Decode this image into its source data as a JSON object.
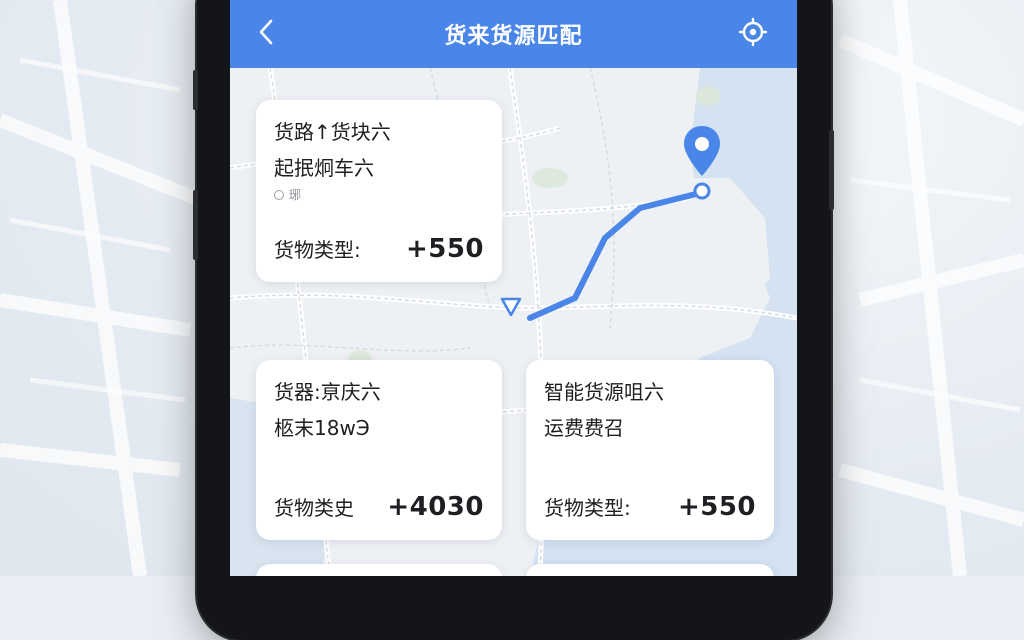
{
  "app": {
    "title": "货来货源匹配"
  },
  "icons": {
    "back": "chevron-left-icon",
    "locate": "location-target-icon",
    "destination": "map-pin-icon",
    "origin": "navigation-arrow-icon"
  },
  "colors": {
    "header": "#4a86e8",
    "route": "#4a86e8",
    "card_bg": "#ffffff"
  },
  "cards": [
    {
      "line1": "货路↑货块六",
      "line2": "起抿炯车六",
      "line3": "琊",
      "type_label": "货物类型:",
      "price": "+550"
    },
    {
      "line1": "货器:亰庆六",
      "line2": "柩末18wЭ",
      "type_label": "货物类史",
      "price": "+4030"
    },
    {
      "line1": "智能货源咀六",
      "line2": "运费费召",
      "type_label": "货物类型:",
      "price": "+550"
    }
  ]
}
